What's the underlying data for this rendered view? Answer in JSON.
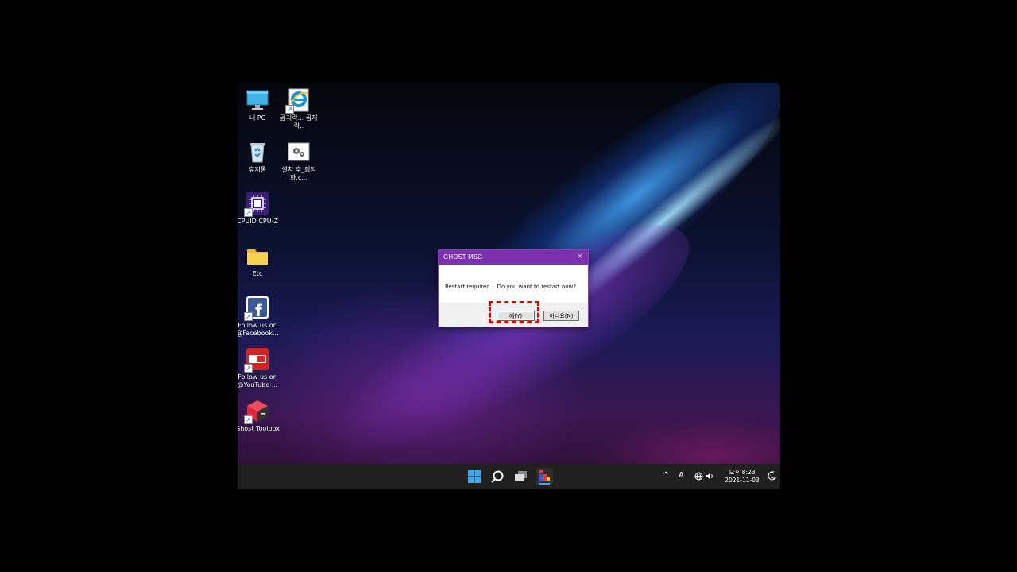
{
  "desktop": {
    "icons": [
      {
        "label": "내 PC",
        "icon": "monitor-icon"
      },
      {
        "label": "곰지락... 곰지락..",
        "icon": "internet-explorer-icon"
      },
      {
        "label": "휴지통",
        "icon": "recycle-bin-icon"
      },
      {
        "label": "설치 후_최적화.c...",
        "icon": "settings-script-icon"
      },
      {
        "label": "CPUID CPU-Z",
        "icon": "cpu-icon"
      },
      {
        "label": "Etc",
        "icon": "folder-icon"
      },
      {
        "label": "Follow us on @Facebook...",
        "icon": "facebook-icon"
      },
      {
        "label": "Follow us on @YouTube ...",
        "icon": "youtube-icon"
      },
      {
        "label": "Ghost Toolbox",
        "icon": "ghost-toolbox-icon"
      }
    ]
  },
  "dialog": {
    "title": "GHOST MSG",
    "close": "✕",
    "message": "Restart required... Do you want to restart now?",
    "yes_label": "예(Y)",
    "no_label": "아니요(N)"
  },
  "taskbar": {
    "icons": [
      "windows-start-icon",
      "search-icon",
      "task-view-icon",
      "ghost-toolbox-taskbar-icon"
    ]
  },
  "tray": {
    "chevron": "^",
    "ime": "A",
    "time": "오후 8:23",
    "date": "2021-11-03"
  },
  "colors": {
    "dialog_title_bg": "#7c2fae",
    "highlight": "#e00000",
    "taskbar_bg": "#202020"
  }
}
